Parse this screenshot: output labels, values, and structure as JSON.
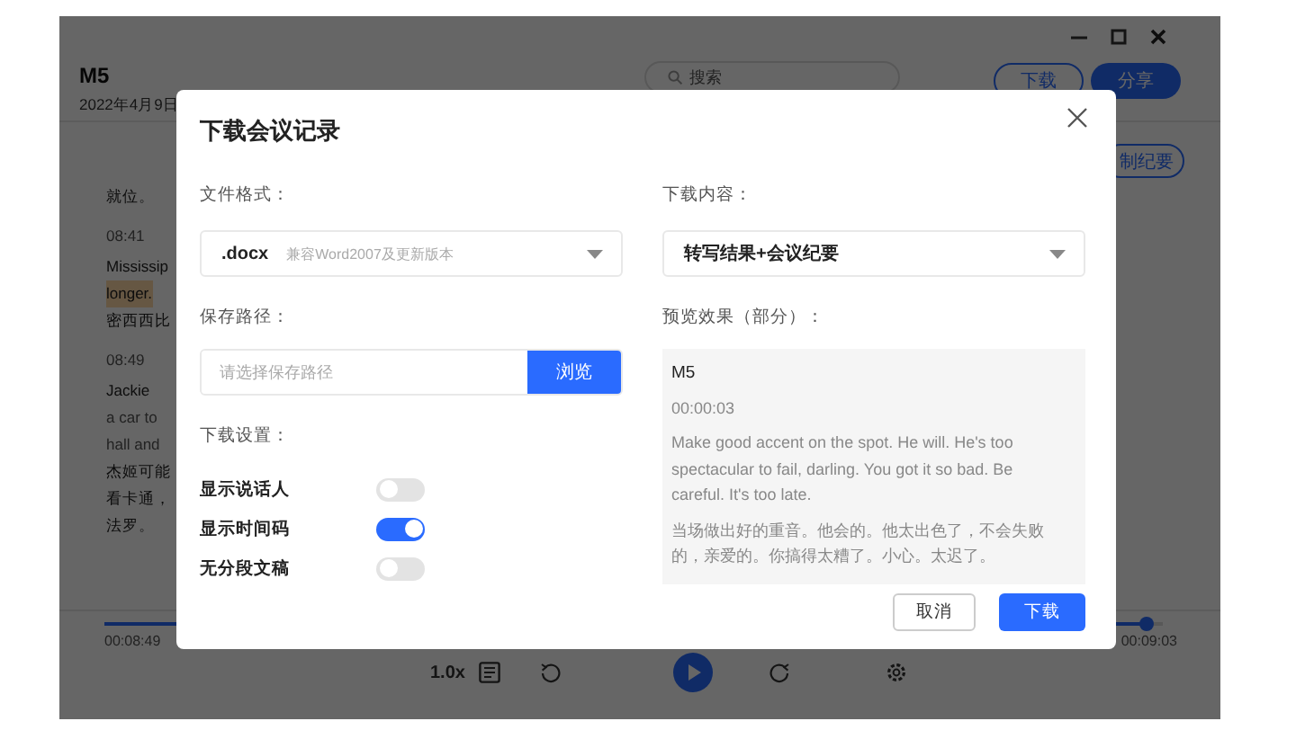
{
  "app": {
    "title": "M5",
    "date": "2022年4月9日",
    "search": {
      "placeholder": "搜索"
    },
    "buttons": [
      {
        "label": "下载",
        "kind": "outline"
      },
      {
        "label": "分享",
        "kind": "primary"
      }
    ],
    "summary_button": "制纪要",
    "transcript": [
      {
        "kind": "text",
        "text": "就位。"
      },
      {
        "kind": "time",
        "text": "08:41"
      },
      {
        "kind": "text",
        "text": "Mississip"
      },
      {
        "kind": "highlight",
        "text": "longer."
      },
      {
        "kind": "text",
        "text": "密西西比"
      },
      {
        "kind": "time",
        "text": "08:49"
      },
      {
        "kind": "text",
        "text": "Jackie"
      },
      {
        "kind": "faint",
        "text": "a car to"
      },
      {
        "kind": "faint",
        "text": "hall and"
      },
      {
        "kind": "text",
        "text": "杰姬可能"
      },
      {
        "kind": "text",
        "text": "看卡通，"
      },
      {
        "kind": "text",
        "text": "法罗。"
      }
    ],
    "player": {
      "level": 0.985,
      "elapsed": "00:08:49",
      "total": "00:09:03",
      "speed": "1.0x"
    }
  },
  "dialog": {
    "title": "下载会议记录",
    "format": {
      "label": "文件格式：",
      "value": ".docx",
      "hint": "兼容Word2007及更新版本"
    },
    "path": {
      "label": "保存路径：",
      "placeholder": "请选择保存路径",
      "button": "浏览"
    },
    "settings": {
      "label": "下载设置：",
      "options": [
        {
          "label": "显示说话人",
          "on": false
        },
        {
          "label": "显示时间码",
          "on": true
        },
        {
          "label": "无分段文稿",
          "on": false
        }
      ]
    },
    "content": {
      "label": "下载内容：",
      "value": "转写结果+会议纪要"
    },
    "preview": {
      "label": "预览效果（部分）：",
      "title": "M5",
      "time": "00:00:03",
      "paragraphs": [
        "Make good accent on the spot. He will. He's too spectacular to fail, darling. You got it so bad. Be careful. It's too late.",
        "当场做出好的重音。他会的。他太出色了，不会失败的，亲爱的。你搞得太糟了。小心。太迟了。"
      ]
    },
    "buttons": [
      {
        "label": "取消",
        "kind": "secondary"
      },
      {
        "label": "下载",
        "kind": "primary"
      }
    ]
  }
}
